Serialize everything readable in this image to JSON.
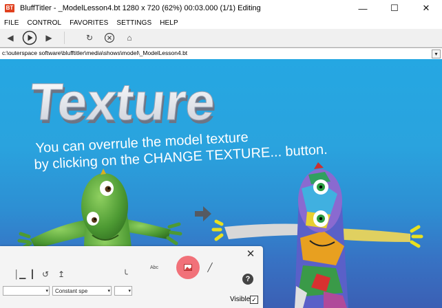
{
  "window": {
    "app_icon": "BT",
    "title": "BluffTitler - _ModelLesson4.bt 1280 x 720 (62%) 00:03.000 (1/1) Editing",
    "minimize": "—",
    "maximize": "☐",
    "close": "✕"
  },
  "menu": [
    "FILE",
    "CONTROL",
    "FAVORITES",
    "SETTINGS",
    "HELP"
  ],
  "toolbar": {
    "prev": "◀",
    "play": "▶",
    "next": "▶",
    "refresh": "↻",
    "stop": "✕",
    "home": "⌂"
  },
  "path": {
    "value": "c:\\outerspace software\\blufftitler\\media\\shows\\model\\_ModelLesson4.bt",
    "dropdown": "▾"
  },
  "scene": {
    "heading": "Texture",
    "line1": "You can overrule the model texture",
    "line2": "by clicking on the CHANGE TEXTURE... button."
  },
  "panel": {
    "close": "✕",
    "combo1_text": "",
    "combo2_text": "Constant spe",
    "combo3_text": "",
    "abc_label": "Abc",
    "help": "?",
    "visible_label": "Visible",
    "visible_check": "✓"
  },
  "colors": {
    "sky_top": "#25a7e2",
    "sky_bottom": "#3b5fb4",
    "character_green": "#5a9e3a",
    "highlight_red": "#f0505a",
    "app_icon": "#e0401e"
  }
}
